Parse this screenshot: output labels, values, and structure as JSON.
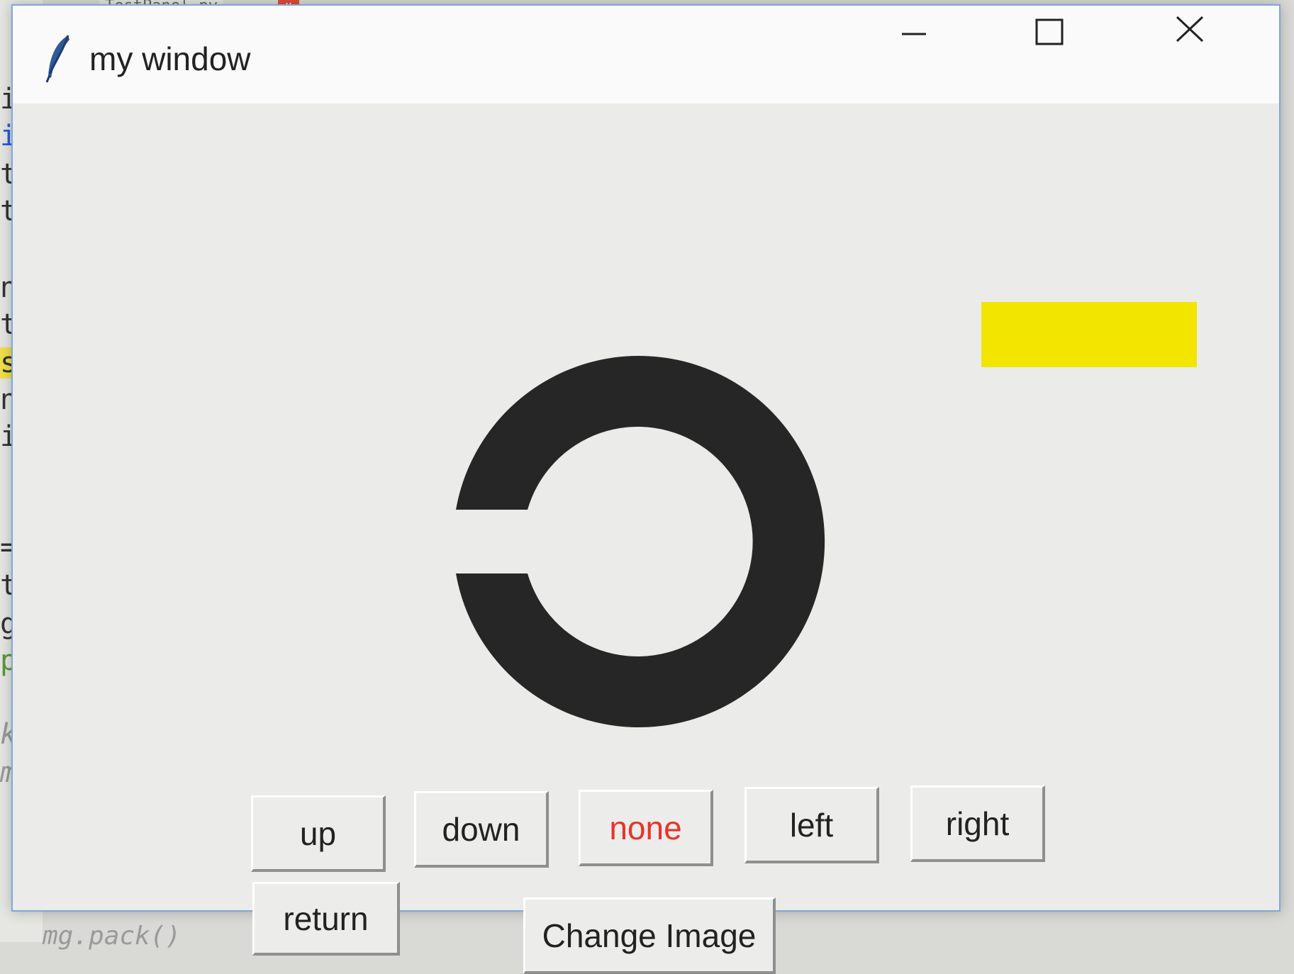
{
  "background_editor": {
    "tab_label": "TestPanel.py",
    "tab_close": "x",
    "code_fragments": [
      "i",
      "i",
      "t",
      "t",
      "n",
      "t",
      "sv",
      "nt",
      "im",
      "=",
      "ti",
      "ge",
      "p'",
      "k.",
      "mg"
    ],
    "bottom_line": "mg.pack()"
  },
  "window": {
    "title": "my window",
    "icon": "feather-icon",
    "controls": {
      "minimize": "minimize-icon",
      "maximize": "maximize-icon",
      "close": "close-icon"
    }
  },
  "canvas": {
    "background_color": "#ebebe9",
    "rectangle_color": "#f2e600",
    "ring_color": "#262626",
    "ring_gap_side": "left"
  },
  "buttons": {
    "up": "up",
    "down": "down",
    "none": "none",
    "left": "left",
    "right": "right",
    "return": "return",
    "change_image": "Change Image"
  },
  "colors": {
    "none_button_text": "#e8332a",
    "window_border": "#7ea7d8"
  }
}
